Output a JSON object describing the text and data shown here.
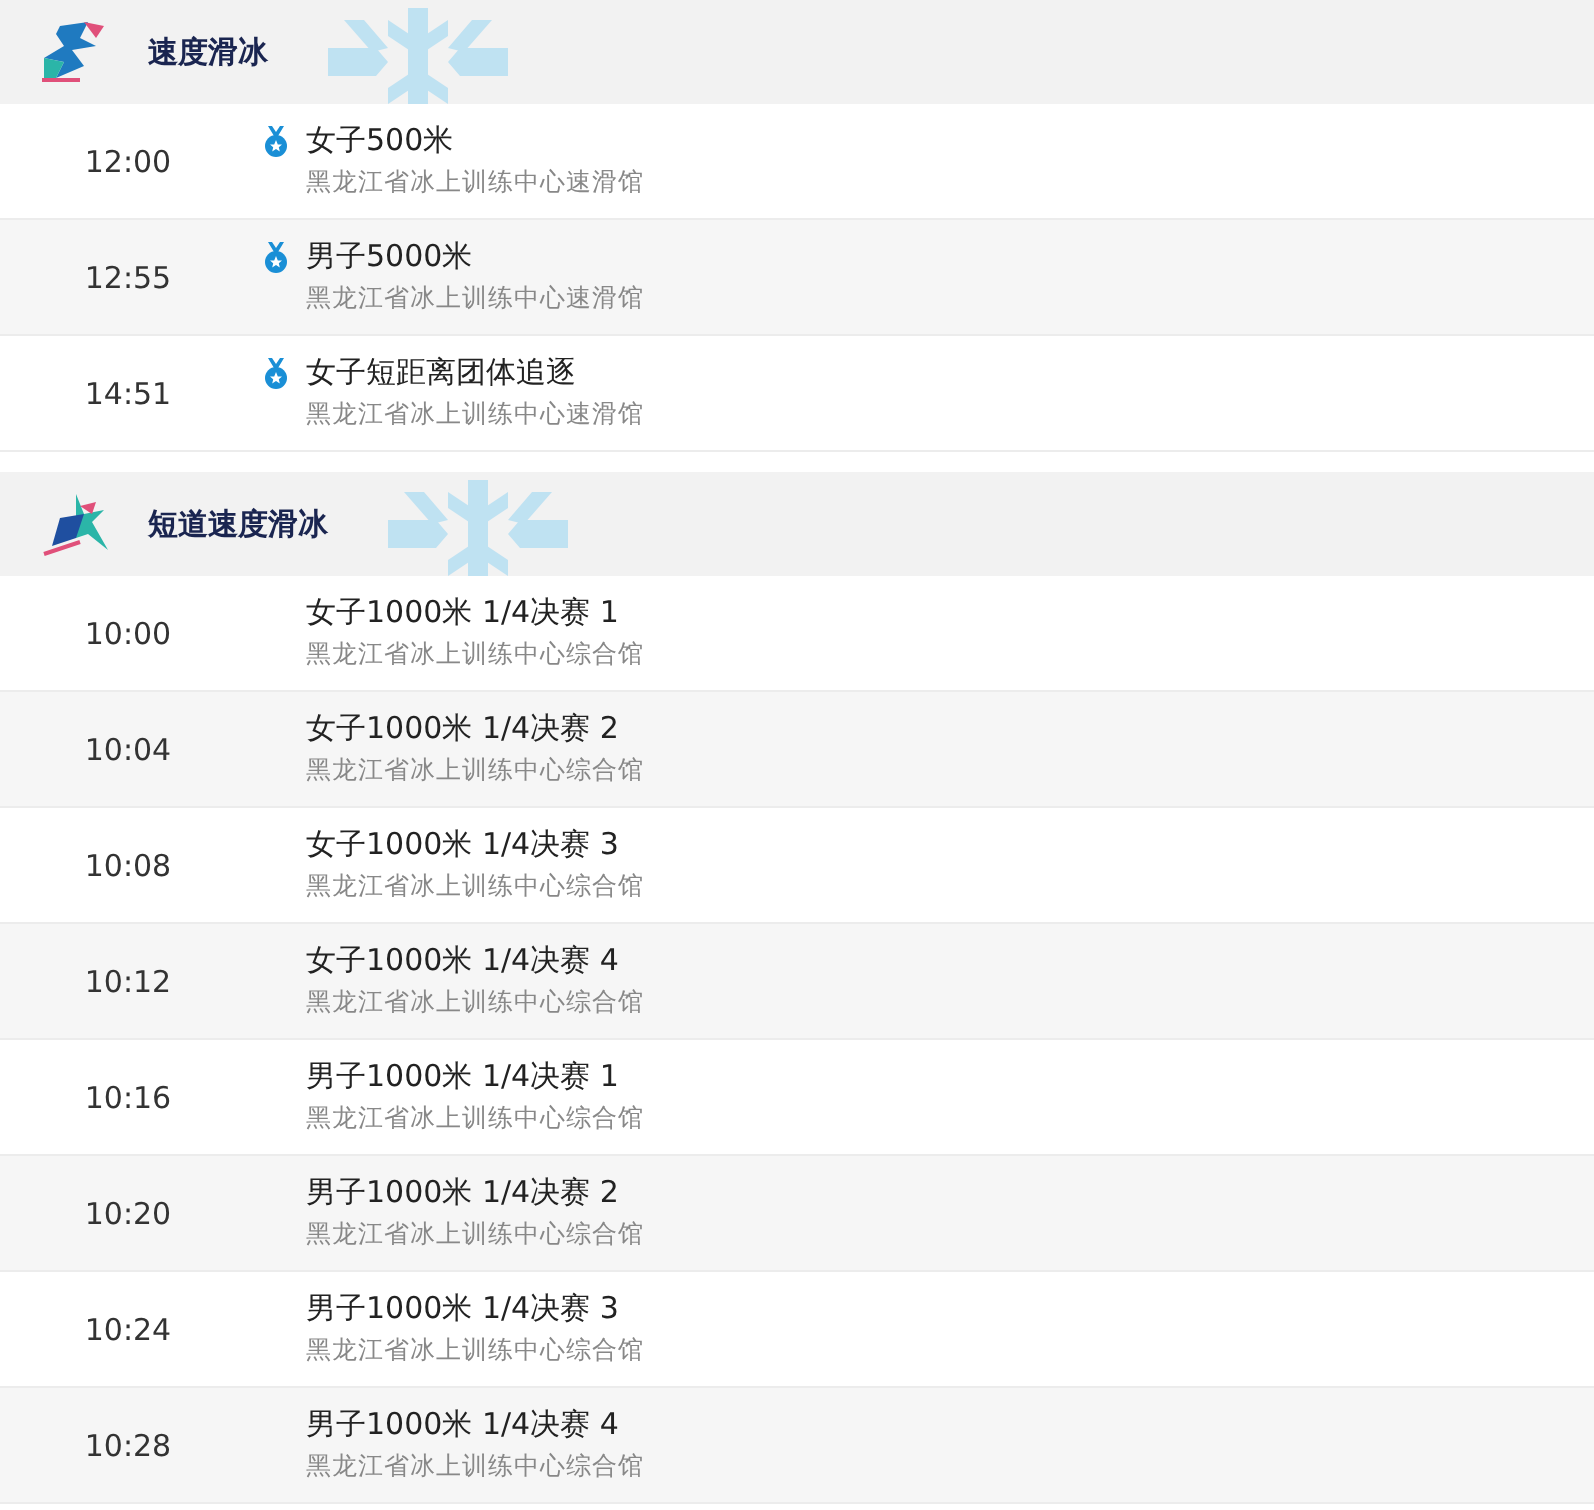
{
  "sections": [
    {
      "title": "速度滑冰",
      "kind": "long",
      "events": [
        {
          "time": "12:00",
          "medal": true,
          "name": "女子500米",
          "venue": "黑龙江省冰上训练中心速滑馆"
        },
        {
          "time": "12:55",
          "medal": true,
          "name": "男子5000米",
          "venue": "黑龙江省冰上训练中心速滑馆"
        },
        {
          "time": "14:51",
          "medal": true,
          "name": "女子短距离团体追逐",
          "venue": "黑龙江省冰上训练中心速滑馆"
        }
      ]
    },
    {
      "title": "短道速度滑冰",
      "kind": "short",
      "events": [
        {
          "time": "10:00",
          "medal": false,
          "name": "女子1000米 1/4决赛 1",
          "venue": "黑龙江省冰上训练中心综合馆"
        },
        {
          "time": "10:04",
          "medal": false,
          "name": "女子1000米 1/4决赛 2",
          "venue": "黑龙江省冰上训练中心综合馆"
        },
        {
          "time": "10:08",
          "medal": false,
          "name": "女子1000米 1/4决赛 3",
          "venue": "黑龙江省冰上训练中心综合馆"
        },
        {
          "time": "10:12",
          "medal": false,
          "name": "女子1000米 1/4决赛 4",
          "venue": "黑龙江省冰上训练中心综合馆"
        },
        {
          "time": "10:16",
          "medal": false,
          "name": "男子1000米 1/4决赛 1",
          "venue": "黑龙江省冰上训练中心综合馆"
        },
        {
          "time": "10:20",
          "medal": false,
          "name": "男子1000米 1/4决赛 2",
          "venue": "黑龙江省冰上训练中心综合馆"
        },
        {
          "time": "10:24",
          "medal": false,
          "name": "男子1000米 1/4决赛 3",
          "venue": "黑龙江省冰上训练中心综合馆"
        },
        {
          "time": "10:28",
          "medal": false,
          "name": "男子1000米 1/4决赛 4",
          "venue": "黑龙江省冰上训练中心综合馆"
        }
      ]
    }
  ]
}
